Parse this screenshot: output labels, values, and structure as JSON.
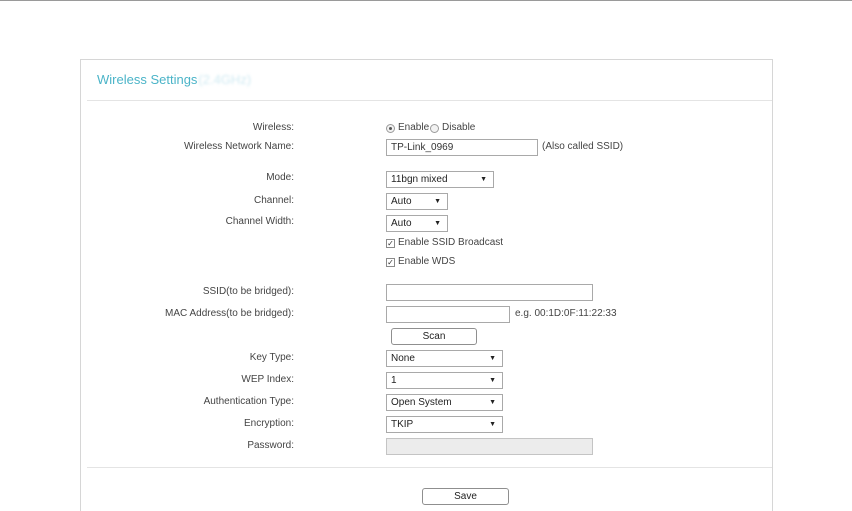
{
  "panel": {
    "title": "Wireless Settings",
    "title_suffix": "(2.4GHz)"
  },
  "wireless": {
    "label": "Wireless:",
    "enable_label": "Enable",
    "disable_label": "Disable",
    "selected": "Enable"
  },
  "network_name": {
    "label": "Wireless Network Name:",
    "value": "TP-Link_0969",
    "hint": "(Also called SSID)"
  },
  "mode": {
    "label": "Mode:",
    "value": "11bgn mixed"
  },
  "channel": {
    "label": "Channel:",
    "value": "Auto"
  },
  "channel_width": {
    "label": "Channel Width:",
    "value": "Auto"
  },
  "ssid_broadcast": {
    "label": "Enable SSID Broadcast",
    "checked": true
  },
  "wds": {
    "label": "Enable WDS",
    "checked": true
  },
  "ssid_bridged": {
    "label": "SSID(to be bridged):",
    "value": ""
  },
  "mac_bridged": {
    "label": "MAC Address(to be bridged):",
    "value": "",
    "hint": "e.g. 00:1D:0F:11:22:33"
  },
  "scan_button": "Scan",
  "key_type": {
    "label": "Key Type:",
    "value": "None"
  },
  "wep_index": {
    "label": "WEP Index:",
    "value": "1"
  },
  "auth_type": {
    "label": "Authentication Type:",
    "value": "Open System"
  },
  "encryption": {
    "label": "Encryption:",
    "value": "TKIP"
  },
  "password": {
    "label": "Password:",
    "value": ""
  },
  "save_button": "Save",
  "icons": {
    "dropdown": "triangle-down-icon",
    "check": "checkmark-icon"
  }
}
